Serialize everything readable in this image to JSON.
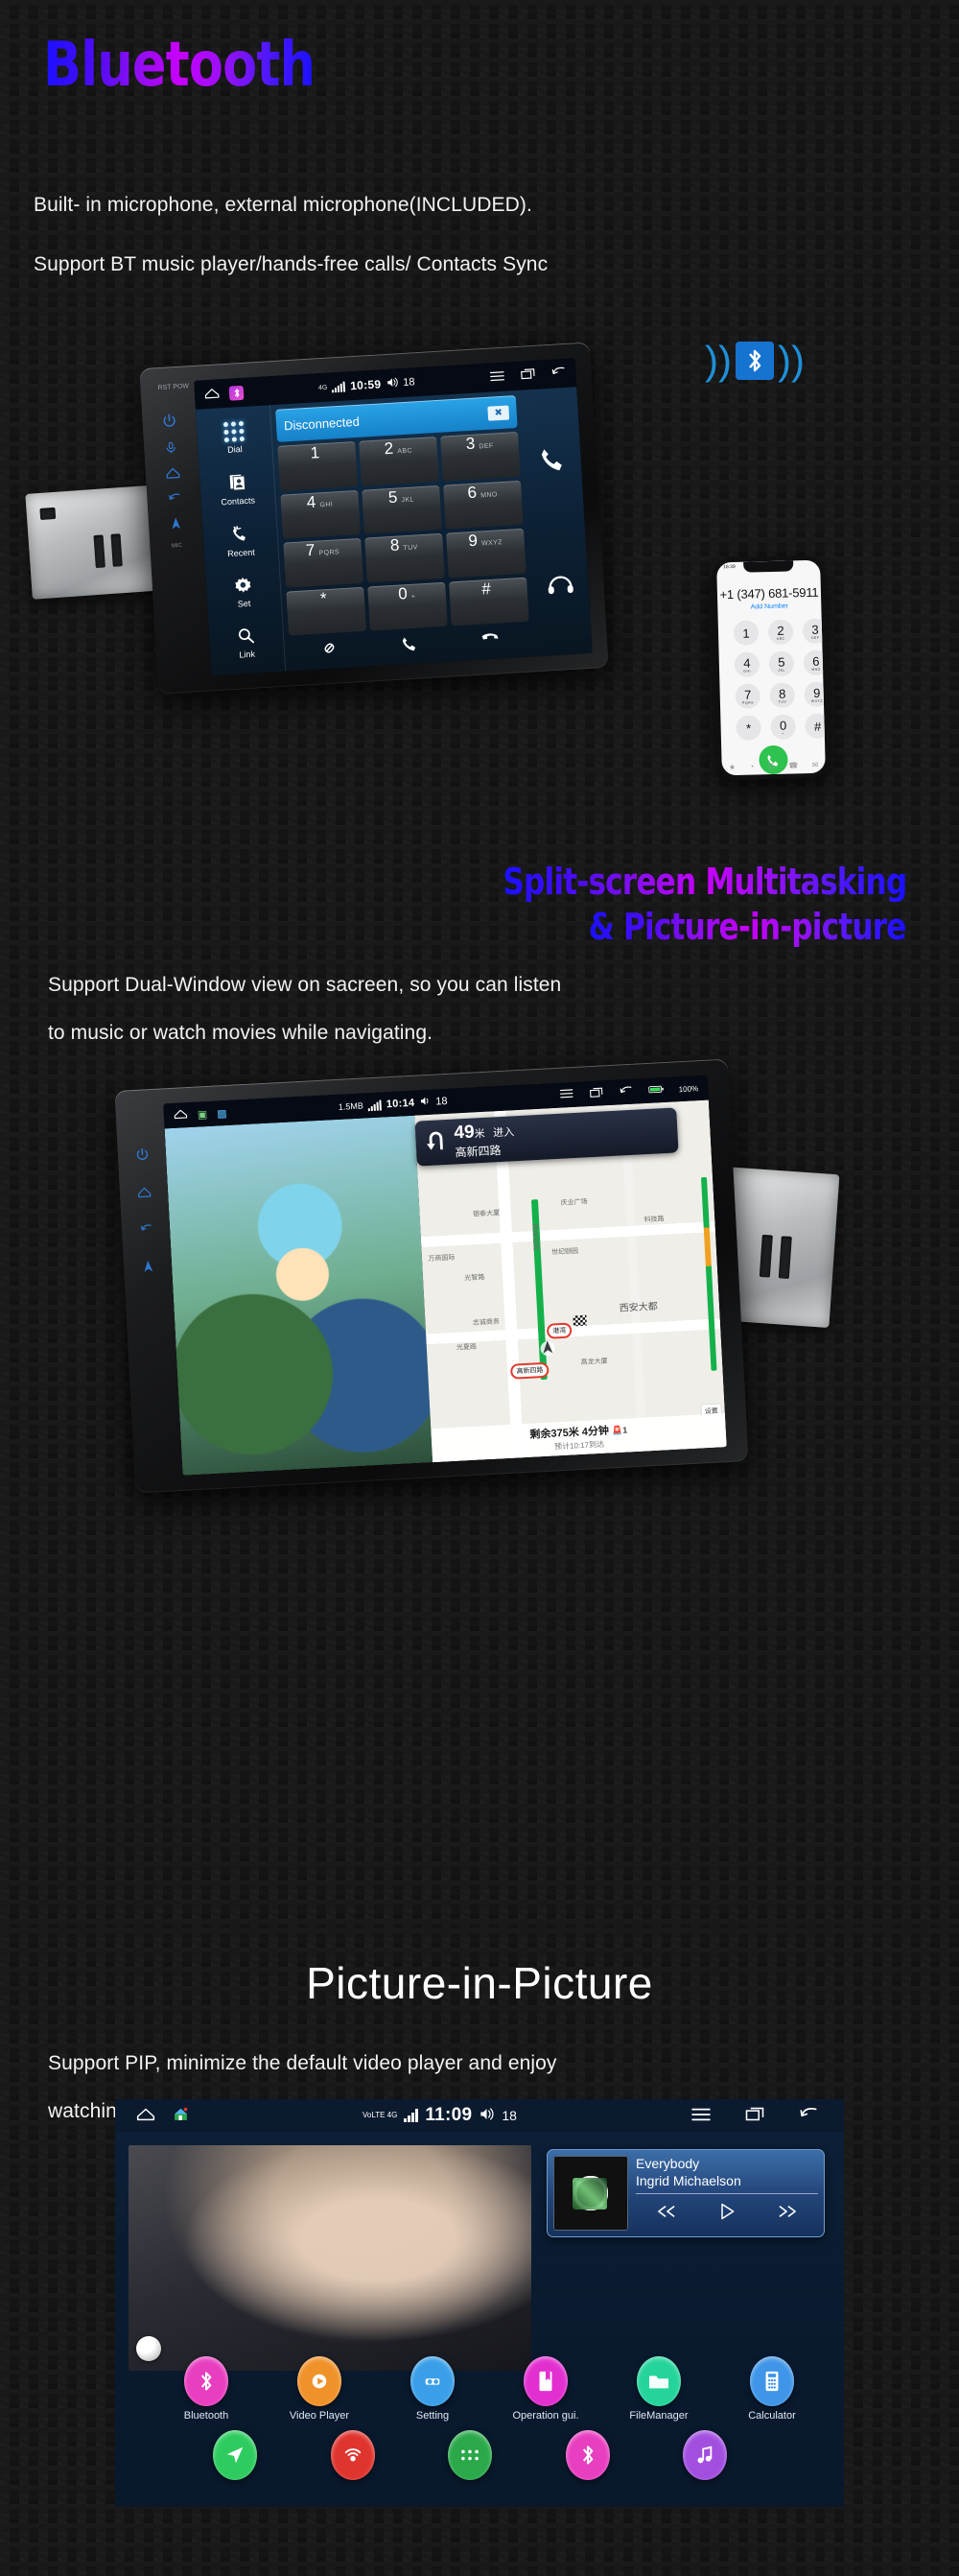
{
  "sections": {
    "bluetooth": {
      "title": "Bluetooth",
      "lines": [
        "Built- in microphone, external microphone(INCLUDED).",
        "Support BT music player/hands-free calls/ Contacts Sync"
      ],
      "headunit": {
        "brand_labels": [
          "RST",
          "POW"
        ],
        "statusbar": {
          "time": "10:59",
          "volume": "18",
          "network": "4G"
        },
        "nav_items": [
          {
            "label": "Dial",
            "icon": "keypad-dots-icon"
          },
          {
            "label": "Contacts",
            "icon": "contacts-icon"
          },
          {
            "label": "Recent",
            "icon": "recent-calls-icon"
          },
          {
            "label": "Set",
            "icon": "gear-icon"
          },
          {
            "label": "Link",
            "icon": "search-icon"
          }
        ],
        "display_status": "Disconnected",
        "keys": [
          {
            "num": "1",
            "sub": ""
          },
          {
            "num": "2",
            "sub": "ABC"
          },
          {
            "num": "3",
            "sub": "DEF"
          },
          {
            "num": "4",
            "sub": "GHI"
          },
          {
            "num": "5",
            "sub": "JKL"
          },
          {
            "num": "6",
            "sub": "MNO"
          },
          {
            "num": "7",
            "sub": "PQRS"
          },
          {
            "num": "8",
            "sub": "TUV"
          },
          {
            "num": "9",
            "sub": "WXYZ"
          },
          {
            "num": "*",
            "sub": ""
          },
          {
            "num": "0",
            "sub": "+"
          },
          {
            "num": "#",
            "sub": ""
          }
        ],
        "right_icons": [
          "call-icon",
          "headset-icon"
        ],
        "bottom_icons": [
          "link-icon",
          "call-icon",
          "hangup-icon"
        ]
      },
      "phone": {
        "status_time": "16:39",
        "number": "+1 (347) 681-5911",
        "add_label": "Add Number",
        "keys": [
          {
            "num": "1",
            "sub": ""
          },
          {
            "num": "2",
            "sub": "ABC"
          },
          {
            "num": "3",
            "sub": "DEF"
          },
          {
            "num": "4",
            "sub": "GHI"
          },
          {
            "num": "5",
            "sub": "JKL"
          },
          {
            "num": "6",
            "sub": "MNO"
          },
          {
            "num": "7",
            "sub": "PQRS"
          },
          {
            "num": "8",
            "sub": "TUV"
          },
          {
            "num": "9",
            "sub": "WXYZ"
          },
          {
            "num": "*",
            "sub": ""
          },
          {
            "num": "0",
            "sub": "+"
          },
          {
            "num": "#",
            "sub": ""
          }
        ],
        "tabs": [
          "★",
          "◔",
          "☷",
          "☎",
          "✉"
        ]
      },
      "bt_logo_icon": "bluetooth-waves-icon"
    },
    "split": {
      "title_line1": "Split-screen Multitasking",
      "title_line2": "& Picture-in-picture",
      "lines": [
        "Support  Dual-Window view on sacreen, so you can listen",
        "to music or watch movies while navigating."
      ],
      "headunit": {
        "statusbar": {
          "time": "10:14",
          "volume": "18",
          "data": "1.5MB",
          "battery": "100%"
        },
        "nav": {
          "distance": "49",
          "unit": "米",
          "action": "进入",
          "road": "高新四路",
          "remaining": "剩余375米  4分钟",
          "eta": "预计10:17到达",
          "lights": "1",
          "map_labels": [
            "世纪颐园",
            "科技路",
            "光智路",
            "西安大都",
            "光夏路",
            "高新四路",
            "庆业广场",
            "银泰大厦",
            "志诚商务",
            "高龙大厦",
            "万商国际"
          ],
          "bubble": "港湾",
          "settings_label": "设置"
        }
      }
    },
    "pip": {
      "title": "Picture-in-Picture",
      "lines": [
        "Support PIP, minimize the default video player and enjoy",
        "watching video when you uas navigation,brower and etc."
      ],
      "screen": {
        "statusbar": {
          "time": "11:09",
          "volume": "18",
          "network": "VoLTE 4G"
        },
        "music": {
          "track": "Everybody",
          "artist": "Ingrid Michaelson",
          "controls": [
            "prev-track-icon",
            "play-icon",
            "next-track-icon"
          ]
        },
        "apps_row1": [
          {
            "label": "Bluetooth",
            "icon": "bluetooth-icon",
            "color": "#e83fc0"
          },
          {
            "label": "Video Player",
            "icon": "video-icon",
            "color": "#f0922a"
          },
          {
            "label": "Setting",
            "icon": "gear-icon",
            "color": "#3a9fe8"
          },
          {
            "label": "Operation gui.",
            "icon": "book-icon",
            "color": "#e22fd0"
          },
          {
            "label": "FileManager",
            "icon": "folder-icon",
            "color": "#24d49a"
          },
          {
            "label": "Calculator",
            "icon": "calculator-icon",
            "color": "#3f95e8"
          }
        ],
        "apps_row2": [
          {
            "label": "",
            "icon": "navigation-icon",
            "color": "#2ecc5f"
          },
          {
            "label": "",
            "icon": "radio-icon",
            "color": "#e0352f"
          },
          {
            "label": "",
            "icon": "apps-grid-icon",
            "color": "#2aa84a"
          },
          {
            "label": "",
            "icon": "bluetooth-icon",
            "color": "#e83fc0"
          },
          {
            "label": "",
            "icon": "music-icon",
            "color": "#a24fe0"
          }
        ]
      }
    }
  },
  "colors": {
    "accent_blue": "#1a10ff",
    "accent_magenta": "#c800ff",
    "status_blue": "#1581c9",
    "link_blue": "#0a84ff"
  }
}
